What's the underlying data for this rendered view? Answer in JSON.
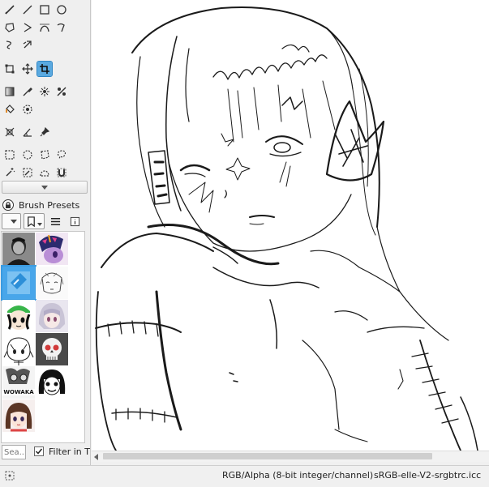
{
  "tools": [
    {
      "name": "paintbrush-tool",
      "icon": "paintbrush-icon"
    },
    {
      "name": "line-tool",
      "icon": "line-icon"
    },
    {
      "name": "rectangle-tool",
      "icon": "rectangle-icon"
    },
    {
      "name": "ellipse-tool",
      "icon": "ellipse-icon"
    },
    {
      "name": "polygon-tool",
      "icon": "polygon-icon"
    },
    {
      "name": "polyline-tool",
      "icon": "polyline-icon"
    },
    {
      "name": "bezier-curve-tool",
      "icon": "bezier-icon"
    },
    {
      "name": "freehand-path-tool",
      "icon": "freehand-path-icon"
    },
    {
      "name": "dynamic-brush-tool",
      "icon": "dynamic-brush-icon"
    },
    {
      "name": "multibrush-tool",
      "icon": "multibrush-icon"
    },
    {
      "name": "transform-tool",
      "icon": "transform-icon"
    },
    {
      "name": "move-tool",
      "icon": "move-icon"
    },
    {
      "name": "crop-tool",
      "icon": "crop-icon",
      "active": true
    },
    {
      "name": "gradient-tool",
      "icon": "gradient-icon"
    },
    {
      "name": "color-picker-tool",
      "icon": "eyedropper-icon"
    },
    {
      "name": "colorize-mask-tool",
      "icon": "colorize-mask-icon"
    },
    {
      "name": "smart-patch-tool",
      "icon": "smart-patch-icon"
    },
    {
      "name": "fill-tool",
      "icon": "paint-bucket-icon"
    },
    {
      "name": "enclose-fill-tool",
      "icon": "enclose-fill-icon"
    },
    {
      "name": "assistant-tool",
      "icon": "assistant-icon"
    },
    {
      "name": "measure-tool",
      "icon": "measure-icon"
    },
    {
      "name": "reference-image-tool",
      "icon": "pin-icon"
    },
    {
      "name": "rectangular-selection-tool",
      "icon": "rect-select-icon"
    },
    {
      "name": "elliptical-selection-tool",
      "icon": "ellipse-select-icon"
    },
    {
      "name": "polygonal-selection-tool",
      "icon": "polygon-select-icon"
    },
    {
      "name": "freehand-selection-tool",
      "icon": "lasso-icon"
    },
    {
      "name": "contiguous-selection-tool",
      "icon": "magic-wand-icon"
    },
    {
      "name": "similar-color-selection-tool",
      "icon": "similar-select-icon"
    },
    {
      "name": "bezier-selection-tool",
      "icon": "bezier-select-icon"
    },
    {
      "name": "magnetic-selection-tool",
      "icon": "magnetic-select-icon"
    }
  ],
  "brush_presets": {
    "title": "Brush Presets",
    "lock_icon": "lock-icon",
    "toolbar": [
      "tag-dropdown",
      "bookmark-icon",
      "list-view-icon",
      "info-icon"
    ],
    "thumbnails": [
      {
        "name": "preset-portrait-bw"
      },
      {
        "name": "preset-pony-purple"
      },
      {
        "name": "preset-blue-anime",
        "selected": true
      },
      {
        "name": "preset-sketch-anime"
      },
      {
        "name": "preset-green-cap"
      },
      {
        "name": "preset-silver-hair"
      },
      {
        "name": "preset-sketch-chibi"
      },
      {
        "name": "preset-skull"
      },
      {
        "name": "preset-wowaka",
        "caption": "WOWAKA"
      },
      {
        "name": "preset-black-hair-face"
      },
      {
        "name": "preset-brown-hair-girl"
      }
    ]
  },
  "search": {
    "placeholder": "Sea...",
    "value": ""
  },
  "filter": {
    "label": "Filter in T",
    "checked": true
  },
  "status": {
    "color_model": "RGB/Alpha (8-bit integer/channel)",
    "profile": "sRGB-elle-V2-srgbtrc.icc"
  },
  "colors": {
    "accent": "#5aa9e0",
    "selected_outline": "#3b9be0",
    "panel_bg": "#efefef",
    "canvas_bg": "#ffffff",
    "ink": "#1a1a1a"
  }
}
